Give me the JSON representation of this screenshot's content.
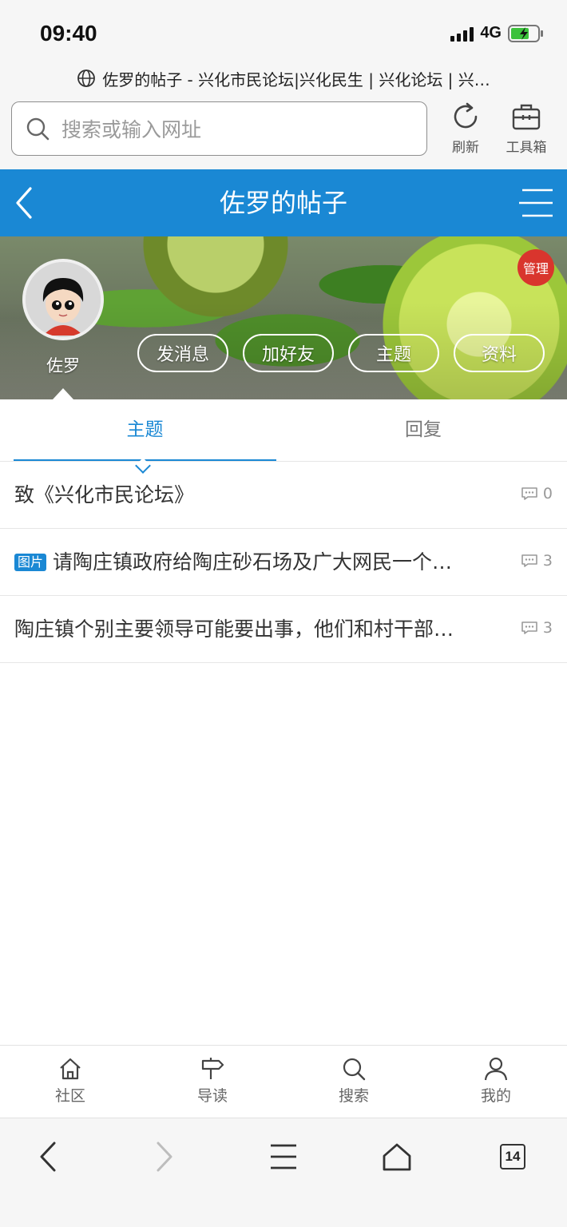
{
  "status": {
    "time": "09:40",
    "network": "4G"
  },
  "browser": {
    "page_title": "佐罗的帖子 - 兴化市民论坛|兴化民生 | 兴化论坛 | 兴…",
    "search_placeholder": "搜索或输入网址",
    "refresh_label": "刷新",
    "toolbox_label": "工具箱",
    "tab_count": "14"
  },
  "header": {
    "title": "佐罗的帖子"
  },
  "profile": {
    "username": "佐罗",
    "manage_label": "管理",
    "actions": [
      "发消息",
      "加好友",
      "主题",
      "资料"
    ]
  },
  "tabs": {
    "topics": "主题",
    "replies": "回复"
  },
  "threads": [
    {
      "title": "致《兴化市民论坛》",
      "tag": "",
      "replies": "0"
    },
    {
      "title": "请陶庄镇政府给陶庄砂石场及广大网民一个…",
      "tag": "图片",
      "replies": "3"
    },
    {
      "title": "陶庄镇个别主要领导可能要出事，他们和村干部…",
      "tag": "",
      "replies": "3"
    }
  ],
  "bottom_nav": [
    "社区",
    "导读",
    "搜索",
    "我的"
  ],
  "colors": {
    "accent": "#1a88d4",
    "badge": "#d9352d"
  }
}
